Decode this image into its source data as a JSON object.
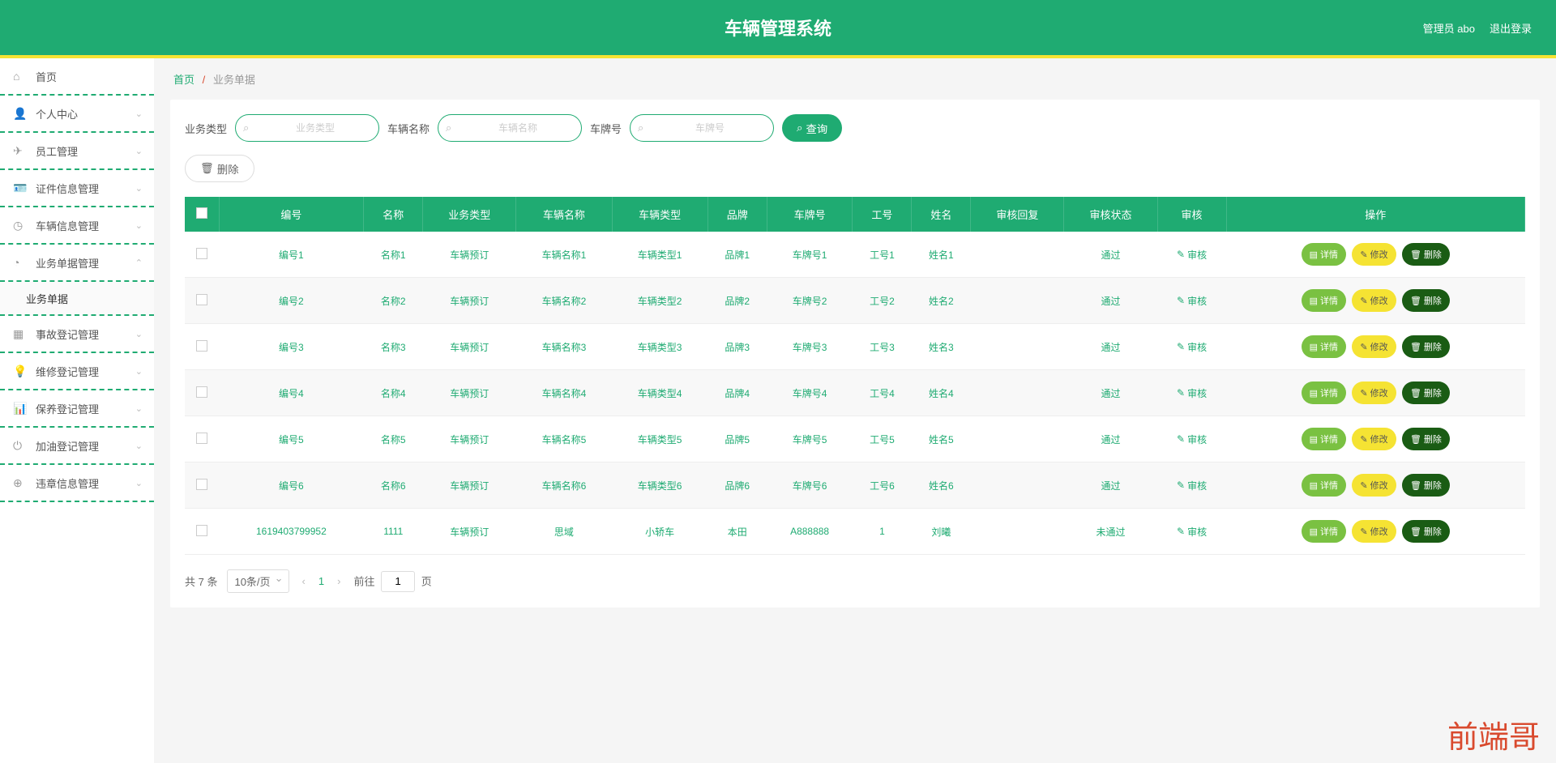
{
  "header": {
    "title": "车辆管理系统",
    "user": "管理员 abo",
    "logout": "退出登录"
  },
  "sidebar": {
    "items": [
      {
        "icon": "home",
        "label": "首页",
        "expandable": false
      },
      {
        "icon": "user",
        "label": "个人中心",
        "expandable": true
      },
      {
        "icon": "plane",
        "label": "员工管理",
        "expandable": true
      },
      {
        "icon": "idcard",
        "label": "证件信息管理",
        "expandable": true
      },
      {
        "icon": "clock",
        "label": "车辆信息管理",
        "expandable": true
      },
      {
        "icon": "gauge",
        "label": "业务单据管理",
        "expandable": true,
        "open": true,
        "sub": [
          "业务单据"
        ]
      },
      {
        "icon": "grid",
        "label": "事故登记管理",
        "expandable": true
      },
      {
        "icon": "bulb",
        "label": "维修登记管理",
        "expandable": true
      },
      {
        "icon": "chart",
        "label": "保养登记管理",
        "expandable": true
      },
      {
        "icon": "power",
        "label": "加油登记管理",
        "expandable": true
      },
      {
        "icon": "globe",
        "label": "违章信息管理",
        "expandable": true
      }
    ]
  },
  "breadcrumb": {
    "home": "首页",
    "current": "业务单据"
  },
  "filters": {
    "type_label": "业务类型",
    "type_placeholder": "业务类型",
    "vname_label": "车辆名称",
    "vname_placeholder": "车辆名称",
    "plate_label": "车牌号",
    "plate_placeholder": "车牌号",
    "query_btn": "查询"
  },
  "delete_btn": "删除",
  "table": {
    "headers": [
      "编号",
      "名称",
      "业务类型",
      "车辆名称",
      "车辆类型",
      "品牌",
      "车牌号",
      "工号",
      "姓名",
      "审核回复",
      "审核状态",
      "审核",
      "操作"
    ],
    "audit_link": "审核",
    "ops": {
      "detail": "详情",
      "modify": "修改",
      "delete": "删除"
    },
    "rows": [
      {
        "id": "编号1",
        "name": "名称1",
        "btype": "车辆预订",
        "vname": "车辆名称1",
        "vtype": "车辆类型1",
        "brand": "品牌1",
        "plate": "车牌号1",
        "emp": "工号1",
        "person": "姓名1",
        "reply": "",
        "status": "通过"
      },
      {
        "id": "编号2",
        "name": "名称2",
        "btype": "车辆预订",
        "vname": "车辆名称2",
        "vtype": "车辆类型2",
        "brand": "品牌2",
        "plate": "车牌号2",
        "emp": "工号2",
        "person": "姓名2",
        "reply": "",
        "status": "通过"
      },
      {
        "id": "编号3",
        "name": "名称3",
        "btype": "车辆预订",
        "vname": "车辆名称3",
        "vtype": "车辆类型3",
        "brand": "品牌3",
        "plate": "车牌号3",
        "emp": "工号3",
        "person": "姓名3",
        "reply": "",
        "status": "通过"
      },
      {
        "id": "编号4",
        "name": "名称4",
        "btype": "车辆预订",
        "vname": "车辆名称4",
        "vtype": "车辆类型4",
        "brand": "品牌4",
        "plate": "车牌号4",
        "emp": "工号4",
        "person": "姓名4",
        "reply": "",
        "status": "通过"
      },
      {
        "id": "编号5",
        "name": "名称5",
        "btype": "车辆预订",
        "vname": "车辆名称5",
        "vtype": "车辆类型5",
        "brand": "品牌5",
        "plate": "车牌号5",
        "emp": "工号5",
        "person": "姓名5",
        "reply": "",
        "status": "通过"
      },
      {
        "id": "编号6",
        "name": "名称6",
        "btype": "车辆预订",
        "vname": "车辆名称6",
        "vtype": "车辆类型6",
        "brand": "品牌6",
        "plate": "车牌号6",
        "emp": "工号6",
        "person": "姓名6",
        "reply": "",
        "status": "通过"
      },
      {
        "id": "1619403799952",
        "name": "1111",
        "btype": "车辆预订",
        "vname": "思域",
        "vtype": "小轿车",
        "brand": "本田",
        "plate": "A888888",
        "emp": "1",
        "person": "刘曦",
        "reply": "",
        "status": "未通过"
      }
    ]
  },
  "pagination": {
    "total_text": "共 7 条",
    "page_size": "10条/页",
    "current": "1",
    "goto_label": "前往",
    "goto_value": "1",
    "page_suffix": "页"
  },
  "watermark": "前端哥",
  "icons": {
    "home": "⌂",
    "user": "👤",
    "plane": "✈",
    "idcard": "🪪",
    "clock": "◷",
    "gauge": "◔",
    "grid": "▦",
    "bulb": "💡",
    "chart": "📊",
    "power": "⏻",
    "globe": "⊕",
    "search": "⌕",
    "trash": "🗑",
    "edit": "✎",
    "doc": "▤"
  }
}
